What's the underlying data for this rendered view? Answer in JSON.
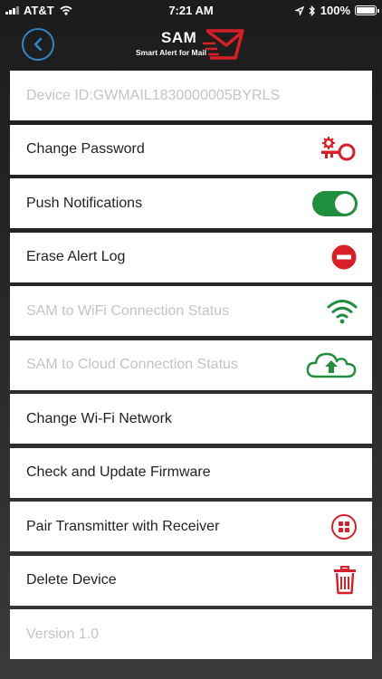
{
  "status_bar": {
    "carrier": "AT&T",
    "time": "7:21 AM",
    "battery": "100%"
  },
  "header": {
    "app_title": "SAM",
    "app_subtitle": "Smart Alert for Mail"
  },
  "rows": [
    {
      "label": "Device ID:GWMAIL1830000005BYRLS",
      "enabled": false,
      "icon": "none"
    },
    {
      "label": "Change Password",
      "enabled": true,
      "icon": "key-icon"
    },
    {
      "label": "Push Notifications",
      "enabled": true,
      "icon": "toggle-switch",
      "toggle_on": true
    },
    {
      "label": "Erase Alert Log",
      "enabled": true,
      "icon": "minus-circle-icon"
    },
    {
      "label": "SAM to WiFi Connection Status",
      "enabled": false,
      "icon": "wifi-icon"
    },
    {
      "label": "SAM to Cloud Connection Status",
      "enabled": false,
      "icon": "cloud-upload-icon"
    },
    {
      "label": "Change Wi-Fi Network",
      "enabled": true,
      "icon": "none"
    },
    {
      "label": "Check and Update Firmware",
      "enabled": true,
      "icon": "none"
    },
    {
      "label": "Pair Transmitter with Receiver",
      "enabled": true,
      "icon": "pair-grid-icon"
    },
    {
      "label": "Delete Device",
      "enabled": true,
      "icon": "trash-icon"
    },
    {
      "label": "Version 1.0",
      "enabled": false,
      "icon": "none"
    }
  ],
  "colors": {
    "accent_red": "#d81e27",
    "accent_green": "#1f8f3e",
    "back_blue": "#2f86c9",
    "disabled_text": "#c4c4c4"
  }
}
